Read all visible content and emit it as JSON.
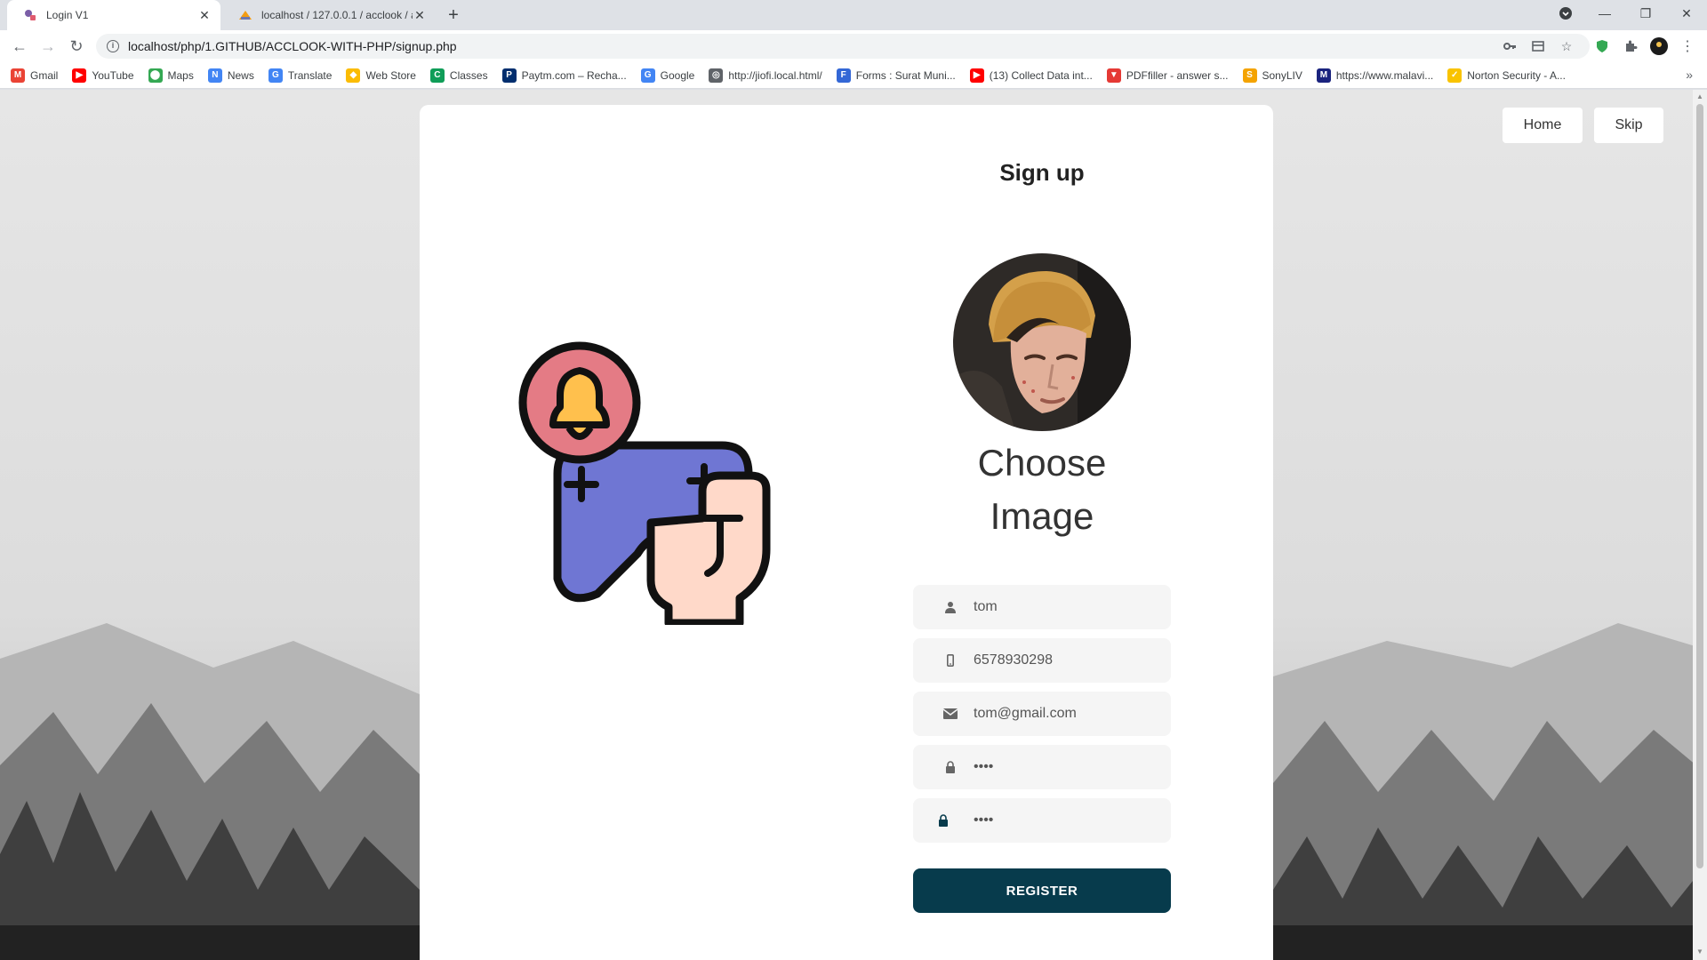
{
  "browser": {
    "tabs": [
      {
        "label": "Login V1",
        "icon": "page-favicon-icon",
        "active": true
      },
      {
        "label": "localhost / 127.0.0.1 / acclook / a",
        "icon": "phpmyadmin-favicon-icon",
        "active": false
      }
    ],
    "url": "localhost/php/1.GITHUB/ACCLOOK-WITH-PHP/signup.php",
    "bookmarks": [
      {
        "label": "Gmail",
        "color": "#ea4335",
        "glyph": "M"
      },
      {
        "label": "YouTube",
        "color": "#ff0000",
        "glyph": "▶"
      },
      {
        "label": "Maps",
        "color": "#34a853",
        "glyph": "⬤"
      },
      {
        "label": "News",
        "color": "#4285f4",
        "glyph": "N"
      },
      {
        "label": "Translate",
        "color": "#4285f4",
        "glyph": "G"
      },
      {
        "label": "Web Store",
        "color": "#fbbc05",
        "glyph": "◆"
      },
      {
        "label": "Classes",
        "color": "#0f9d58",
        "glyph": "C"
      },
      {
        "label": "Paytm.com – Recha...",
        "color": "#002e6e",
        "glyph": "P"
      },
      {
        "label": "Google",
        "color": "#4285f4",
        "glyph": "G"
      },
      {
        "label": "http://jiofi.local.html/",
        "color": "#5f6368",
        "glyph": "◎"
      },
      {
        "label": "Forms : Surat Muni...",
        "color": "#3367d6",
        "glyph": "F"
      },
      {
        "label": "(13) Collect Data int...",
        "color": "#ff0000",
        "glyph": "▶"
      },
      {
        "label": "PDFfiller - answer s...",
        "color": "#e53935",
        "glyph": "▼"
      },
      {
        "label": "SonyLIV",
        "color": "#f4a300",
        "glyph": "S"
      },
      {
        "label": "https://www.malavi...",
        "color": "#1a237e",
        "glyph": "M"
      },
      {
        "label": "Norton Security - A...",
        "color": "#f9c300",
        "glyph": "✓"
      }
    ]
  },
  "nav": {
    "home_label": "Home",
    "skip_label": "Skip"
  },
  "form": {
    "title": "Sign up",
    "choose_line1": "Choose",
    "choose_line2": "Image",
    "fields": [
      {
        "icon": "user-icon",
        "value": "tom"
      },
      {
        "icon": "mobile-phone-icon",
        "value": "6578930298"
      },
      {
        "icon": "envelope-icon",
        "value": "tom@gmail.com"
      },
      {
        "icon": "lock-icon",
        "value": "••••"
      },
      {
        "icon": "lock-icon",
        "value": "••••"
      }
    ],
    "register_label": "REGISTER"
  },
  "colors": {
    "register_bg": "#073b4c",
    "page_bg": "#e9e9e9"
  }
}
